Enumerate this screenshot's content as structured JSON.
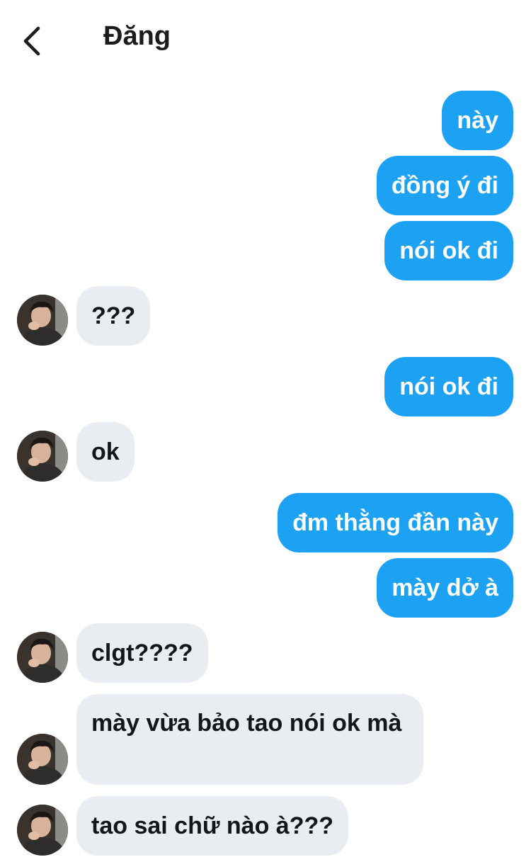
{
  "header": {
    "title": "Đăng",
    "back_icon": "chevron-left-icon"
  },
  "messages": [
    {
      "dir": "out",
      "text": "này"
    },
    {
      "dir": "out",
      "text": "đồng ý đi"
    },
    {
      "dir": "out",
      "text": "nói ok đi"
    },
    {
      "dir": "in",
      "text": "???"
    },
    {
      "dir": "out",
      "text": "nói ok đi"
    },
    {
      "dir": "in",
      "text": "ok"
    },
    {
      "dir": "out",
      "text": "đm thằng đần này"
    },
    {
      "dir": "out",
      "text": "mày dở à"
    },
    {
      "dir": "in",
      "text": "clgt????"
    },
    {
      "dir": "in",
      "text": "mày vừa bảo tao nói ok mà"
    },
    {
      "dir": "in",
      "text": "tao sai chữ nào à???"
    }
  ],
  "colors": {
    "outgoing": "#1da1f2",
    "incoming": "#e9ecf0",
    "outgoing_text": "#ffffff",
    "incoming_text": "#14171a"
  }
}
